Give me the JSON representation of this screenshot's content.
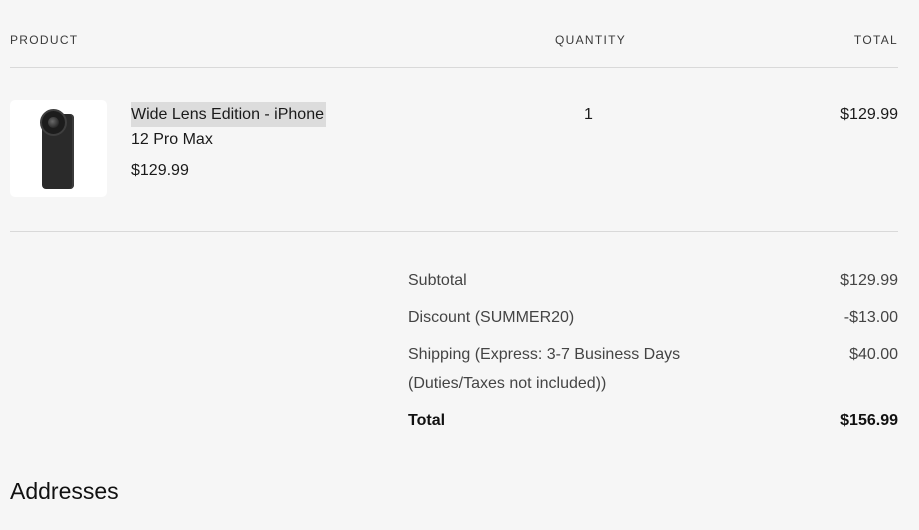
{
  "table_headers": {
    "product": "PRODUCT",
    "quantity": "QUANTITY",
    "total": "TOTAL"
  },
  "line_item": {
    "image_icon": "phone-with-lens-icon",
    "title_line1": "Wide Lens Edition - iPhone",
    "title_line2": "12 Pro Max",
    "unit_price": "$129.99",
    "quantity": "1",
    "line_total": "$129.99"
  },
  "summary": {
    "subtotal_label": "Subtotal",
    "subtotal_value": "$129.99",
    "discount_label": "Discount (SUMMER20)",
    "discount_value": "-$13.00",
    "shipping_label_line1": "Shipping (Express: 3-7 Business Days",
    "shipping_label_line2": "(Duties/Taxes not included))",
    "shipping_value": "$40.00",
    "total_label": "Total",
    "total_value": "$156.99"
  },
  "addresses_heading": "Addresses",
  "colors": {
    "background": "#f6f6f6",
    "divider": "#d9d9d9",
    "text": "#1a1a1a",
    "selection_highlight": "#dcdcdc"
  }
}
